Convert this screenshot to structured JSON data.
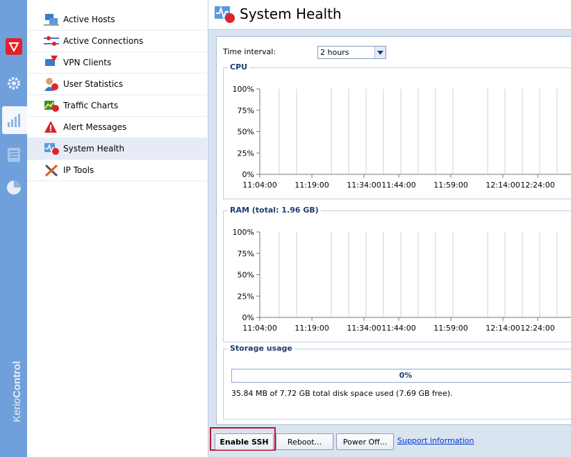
{
  "brand": {
    "part1": "Kerio",
    "part2": "Control"
  },
  "nav": {
    "items": [
      {
        "label": "Active Hosts",
        "icon": "active-hosts-icon"
      },
      {
        "label": "Active Connections",
        "icon": "active-connections-icon"
      },
      {
        "label": "VPN Clients",
        "icon": "vpn-clients-icon"
      },
      {
        "label": "User Statistics",
        "icon": "user-statistics-icon"
      },
      {
        "label": "Traffic Charts",
        "icon": "traffic-charts-icon"
      },
      {
        "label": "Alert Messages",
        "icon": "alert-messages-icon"
      },
      {
        "label": "System Health",
        "icon": "system-health-icon"
      },
      {
        "label": "IP Tools",
        "icon": "ip-tools-icon"
      }
    ],
    "selected": "System Health"
  },
  "main": {
    "title": "System Health",
    "interval_label": "Time interval:",
    "interval_value": "2 hours",
    "storage": {
      "title": "Storage usage",
      "percent": 0,
      "percent_label": "0%",
      "text": "35.84 MB of 7.72 GB total disk space used (7.69 GB free)."
    }
  },
  "buttons": {
    "ssh": "Enable SSH",
    "reboot": "Reboot...",
    "poweroff": "Power Off...",
    "support": "Support information"
  },
  "colors": {
    "leftbar": "#6fa0dc",
    "accent": "#1e3c6e",
    "highlight": "#c0142a"
  },
  "chart_data": [
    {
      "type": "line",
      "title": "CPU",
      "yticks": [
        "100%",
        "75%",
        "50%",
        "25%",
        "0%"
      ],
      "ylim": [
        0,
        100
      ],
      "xticks": [
        "11:04:00",
        "11:19:00",
        "11:34:00",
        "11:44:00",
        "11:59:00",
        "12:14:00",
        "12:24:00"
      ],
      "grid": true,
      "series": []
    },
    {
      "type": "line",
      "title": "RAM (total: 1.96 GB)",
      "yticks": [
        "100%",
        "75%",
        "50%",
        "25%",
        "0%"
      ],
      "ylim": [
        0,
        100
      ],
      "xticks": [
        "11:04:00",
        "11:19:00",
        "11:34:00",
        "11:44:00",
        "11:59:00",
        "12:14:00",
        "12:24:00"
      ],
      "grid": true,
      "series": []
    }
  ]
}
